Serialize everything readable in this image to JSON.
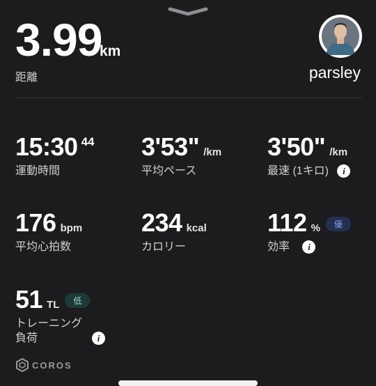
{
  "distance": {
    "value": "3.99",
    "unit": "km",
    "label": "距離"
  },
  "user": {
    "name": "parsley"
  },
  "stats": {
    "time": {
      "value": "15:30",
      "sup": "44",
      "label": "運動時間"
    },
    "avg_pace": {
      "value": "3'53\"",
      "unit": "/km",
      "label": "平均ペース"
    },
    "best_pace": {
      "value": "3'50\"",
      "unit": "/km",
      "label": "最速 (1キロ)"
    },
    "avg_hr": {
      "value": "176",
      "unit": "bpm",
      "label": "平均心拍数"
    },
    "calories": {
      "value": "234",
      "unit": "kcal",
      "label": "カロリー"
    },
    "efficiency": {
      "value": "112",
      "unit": "%",
      "badge": "優",
      "label": "効率"
    },
    "training_load": {
      "value": "51",
      "unit": "TL",
      "badge": "低",
      "label_line1": "トレーニング",
      "label_line2": "負荷"
    }
  },
  "info_icon_glyph": "i",
  "brand": "COROS",
  "colors": {
    "background": "#1c1c1e",
    "badge_good": "#7f9de4",
    "badge_low": "#9ed2c9"
  }
}
